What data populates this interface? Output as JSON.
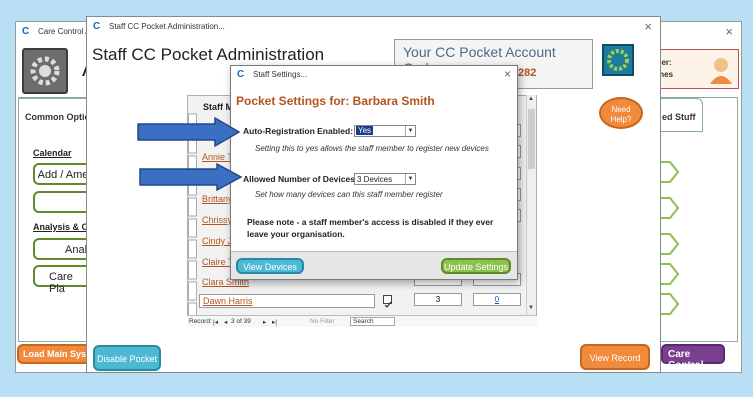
{
  "main_window": {
    "title": "Care Control Adr",
    "tabs": {
      "common_options": "Common Optio",
      "assisted_stuff": "ed Stuff"
    },
    "side_links": {
      "calendar": "Calendar",
      "analysis": "Analysis & Co"
    },
    "side_buttons": [
      "Add / Ame",
      "",
      "Anal",
      "Care Pla"
    ],
    "user_label": "ser:",
    "user_name": "mes",
    "load_main_label": "Load Main Sys",
    "care_control_label": "Care Control"
  },
  "staff_window": {
    "title": "Staff CC Pocket Administration...",
    "heading": "Staff CC Pocket Administration",
    "account_code_label": "Your CC Pocket Account Code:",
    "account_code_value": "282",
    "column_header": "Staff M",
    "staff": [
      {
        "name": "Annie T"
      },
      {
        "name": "Brittany"
      },
      {
        "name": "Chrissy"
      },
      {
        "name": "Cindy Jo"
      },
      {
        "name": "Claire T"
      },
      {
        "name": "Clara Smith"
      },
      {
        "name": "Dawn Harris",
        "devices": "3",
        "regs": "0"
      }
    ],
    "record_nav": {
      "label": "Record:",
      "position": "3 of 39",
      "filter": "No Filter",
      "search": "Search"
    },
    "need_help": "Need Help?",
    "disable_pocket": "Disable Pocket",
    "view_record": "View Record"
  },
  "dialog": {
    "title": "Staff Settings...",
    "heading": "Pocket Settings for: Barbara Smith",
    "auto_reg_label": "Auto-Registration Enabled:",
    "auto_reg_value": "Yes",
    "auto_reg_help": "Setting this to yes allows the staff member to register new devices",
    "allowed_label": "Allowed Number of Devices",
    "allowed_value": "3 Devices",
    "allowed_help": "Set how many devices can this staff member register",
    "note": "Please note - a staff member's access is disabled if they ever leave your organisation.",
    "view_devices": "View Devices",
    "update_settings": "Update Settings"
  },
  "colors": {
    "accent_green": "#8dc04d",
    "accent_blue": "#4db8d4",
    "accent_orange": "#f08a3c",
    "link": "#b2541e",
    "heading": "#b2541e",
    "arrow": "#3a6fc4"
  }
}
